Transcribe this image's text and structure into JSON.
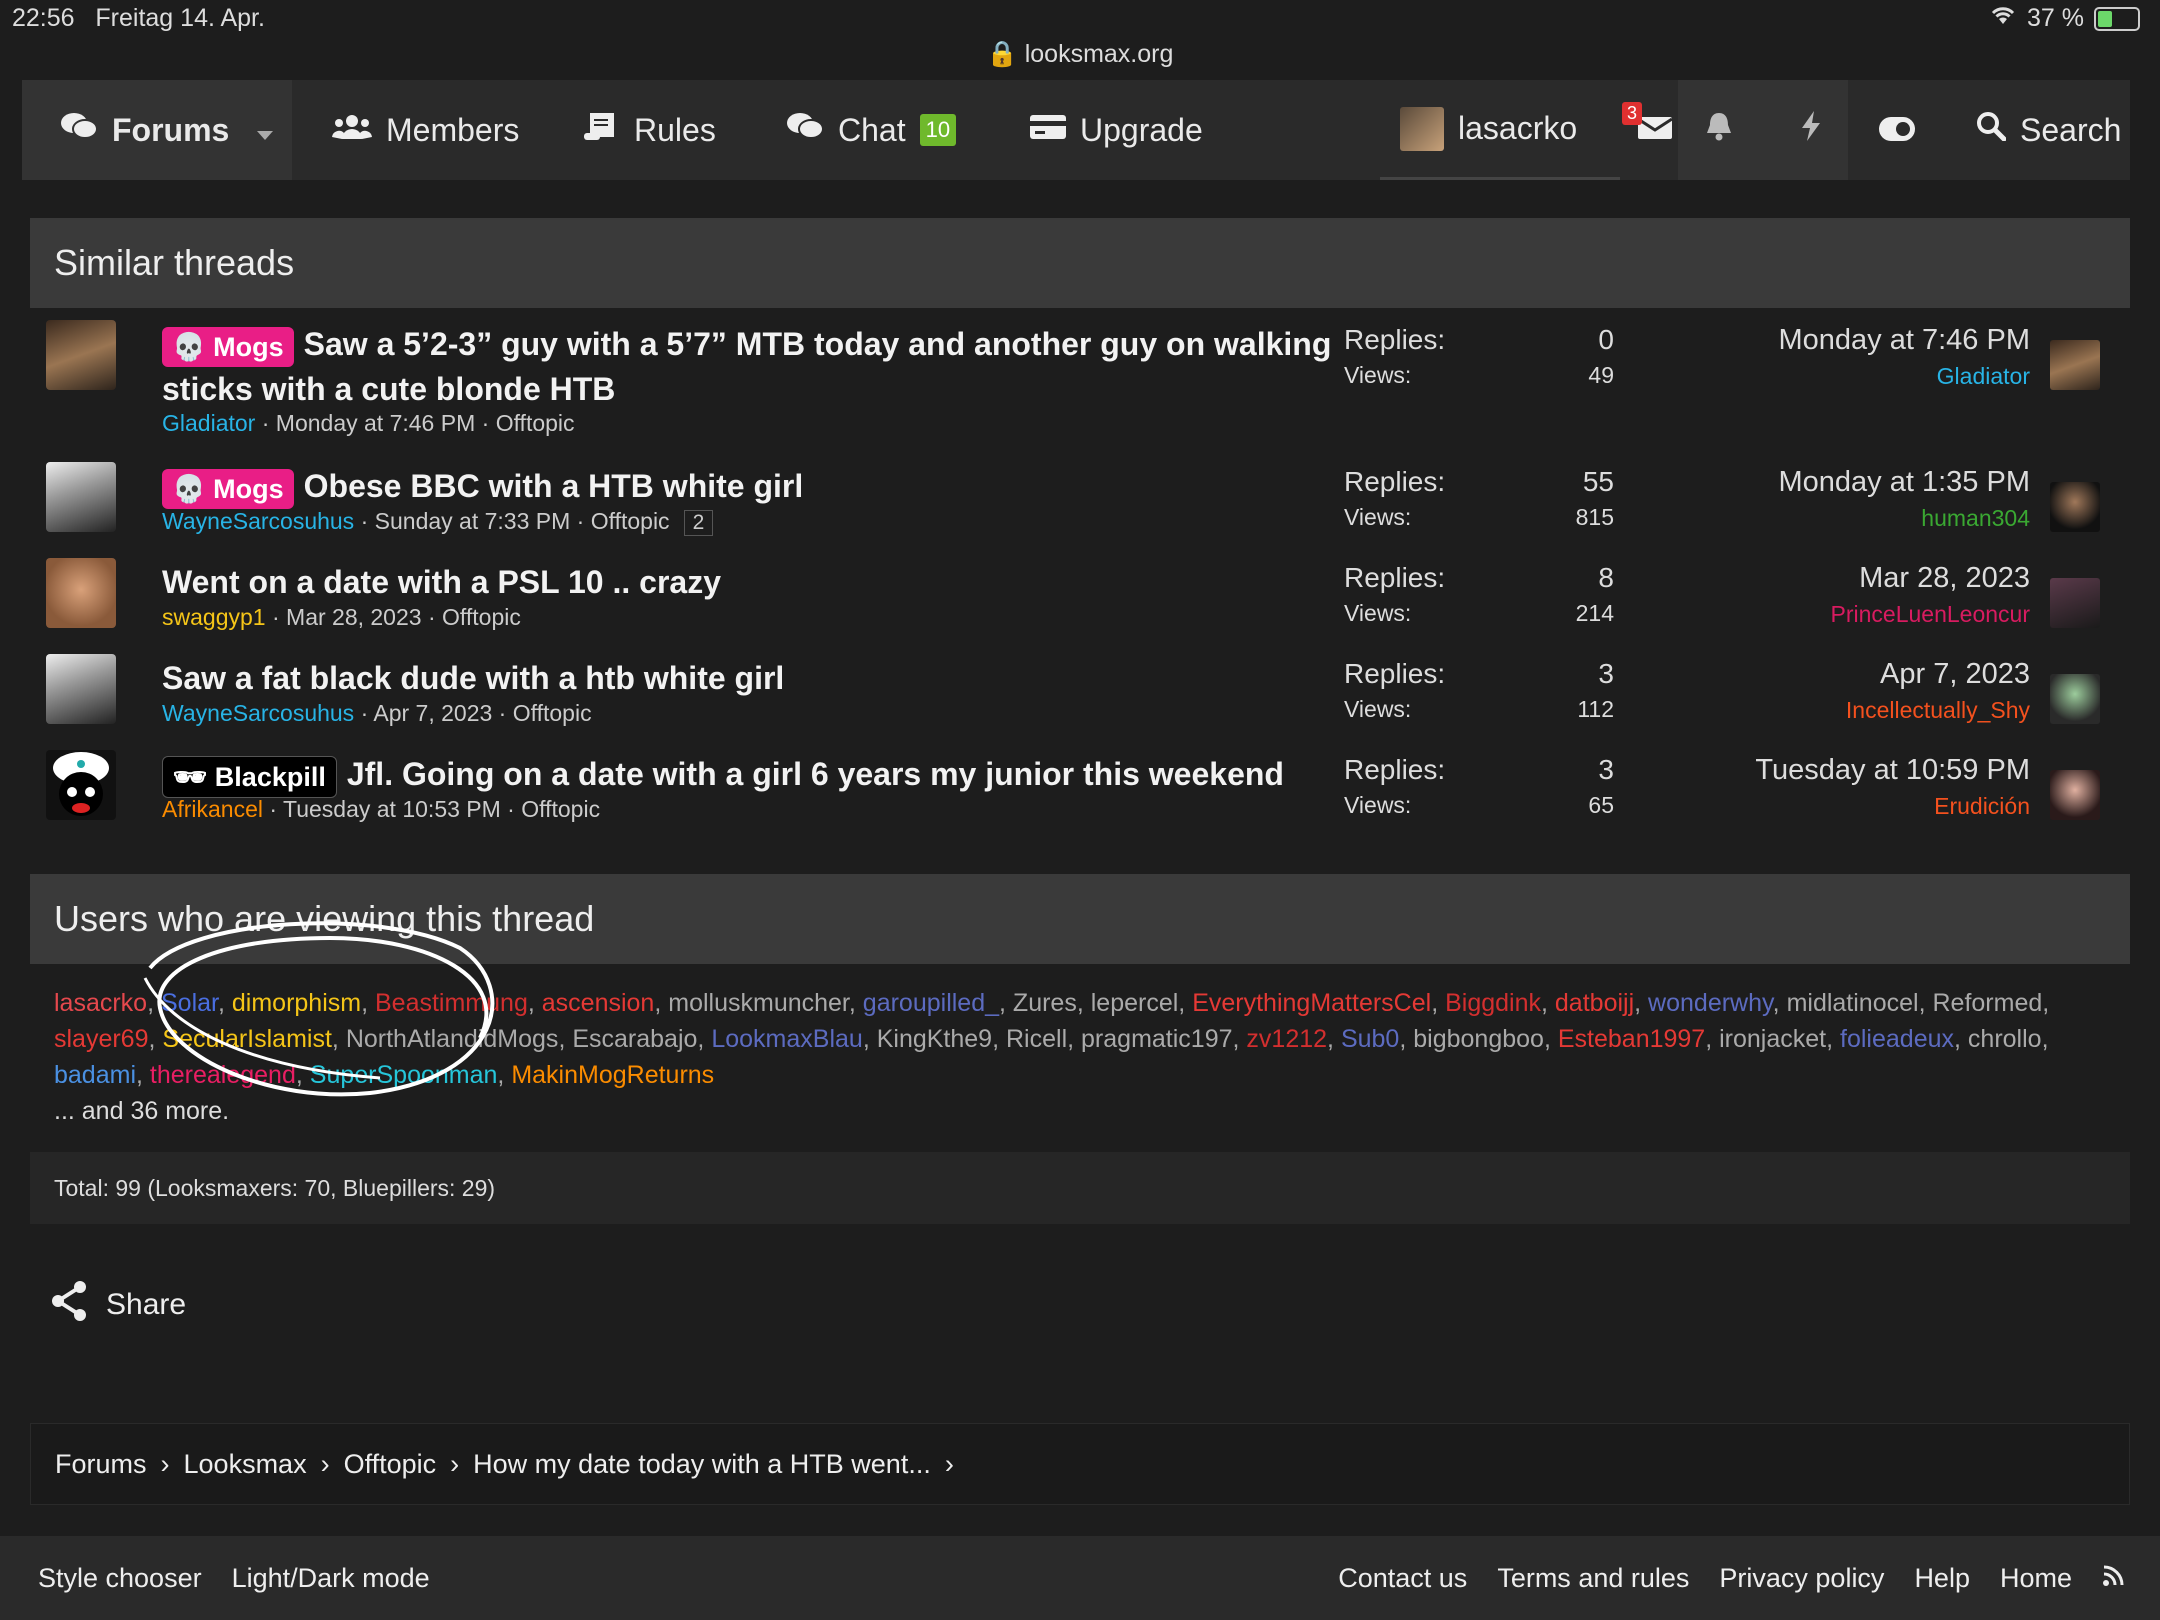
{
  "status": {
    "time": "22:56",
    "date": "Freitag 14. Apr.",
    "url": "looksmax.org",
    "battery": "37 %"
  },
  "nav": {
    "forums": "Forums",
    "members": "Members",
    "rules": "Rules",
    "chat": "Chat",
    "chat_badge": "10",
    "upgrade": "Upgrade",
    "username": "lasacrko",
    "inbox_badge": "3",
    "search": "Search"
  },
  "similar": {
    "heading": "Similar threads",
    "threads": [
      {
        "label": "Mogs",
        "title": "Saw a 5’2-3” guy with a 5’7” MTB today and another guy on walking sticks with a cute blonde HTB",
        "author": "Gladiator",
        "date": "Monday at 7:46 PM",
        "forum": "Offtopic",
        "pages": "",
        "replies_label": "Replies:",
        "replies": "0",
        "views_label": "Views:",
        "views": "49",
        "last_date": "Monday at 7:46 PM",
        "last_user": "Gladiator"
      },
      {
        "label": "Mogs",
        "title": "Obese BBC with a HTB white girl",
        "author": "WayneSarcosuhus",
        "date": "Sunday at 7:33 PM",
        "forum": "Offtopic",
        "pages": "2",
        "replies_label": "Replies:",
        "replies": "55",
        "views_label": "Views:",
        "views": "815",
        "last_date": "Monday at 1:35 PM",
        "last_user": "human304"
      },
      {
        "label": "",
        "title": "Went on a date with a PSL 10 .. crazy",
        "author": "swaggyp1",
        "date": "Mar 28, 2023",
        "forum": "Offtopic",
        "pages": "",
        "replies_label": "Replies:",
        "replies": "8",
        "views_label": "Views:",
        "views": "214",
        "last_date": "Mar 28, 2023",
        "last_user": "PrinceLuenLeoncur"
      },
      {
        "label": "",
        "title": "Saw a fat black dude with a htb white girl",
        "author": "WayneSarcosuhus",
        "date": "Apr 7, 2023",
        "forum": "Offtopic",
        "pages": "",
        "replies_label": "Replies:",
        "replies": "3",
        "views_label": "Views:",
        "views": "112",
        "last_date": "Apr 7, 2023",
        "last_user": "Incellectually_Shy"
      },
      {
        "label": "Blackpill",
        "title": "Jfl. Going on a date with a girl 6 years my junior this weekend",
        "author": "Afrikancel",
        "date": "Tuesday at 10:53 PM",
        "forum": "Offtopic",
        "pages": "",
        "replies_label": "Replies:",
        "replies": "3",
        "views_label": "Views:",
        "views": "65",
        "last_date": "Tuesday at 10:59 PM",
        "last_user": "Erudición"
      }
    ]
  },
  "viewers": {
    "heading": "Users who are viewing this thread",
    "users": [
      {
        "name": "lasacrko",
        "color": "#e5484d"
      },
      {
        "name": "Solar",
        "color": "#4a6ee0"
      },
      {
        "name": "dimorphism",
        "color": "#f5c518"
      },
      {
        "name": "Beastimmung",
        "color": "#d32f2f"
      },
      {
        "name": "ascension",
        "color": "#e53935"
      },
      {
        "name": "molluskmuncher",
        "color": "#aaaaaa"
      },
      {
        "name": "garoupilled_",
        "color": "#5c6bc0"
      },
      {
        "name": "Zures",
        "color": "#aaaaaa"
      },
      {
        "name": "lepercel",
        "color": "#aaaaaa"
      },
      {
        "name": "EverythingMattersCel",
        "color": "#e53935"
      },
      {
        "name": "Biggdink",
        "color": "#d32f2f"
      },
      {
        "name": "datboijj",
        "color": "#e53935"
      },
      {
        "name": "wonderwhy",
        "color": "#5c6bc0"
      },
      {
        "name": "midlatinocel",
        "color": "#aaaaaa"
      },
      {
        "name": "Reformed",
        "color": "#aaaaaa"
      },
      {
        "name": "slayer69",
        "color": "#e53935"
      },
      {
        "name": "SecularIslamist",
        "color": "#f5c518"
      },
      {
        "name": "NorthAtlandidMogs",
        "color": "#aaaaaa"
      },
      {
        "name": "Escarabajo",
        "color": "#aaaaaa"
      },
      {
        "name": "LookmaxBlau",
        "color": "#5c6bc0"
      },
      {
        "name": "KingKthe9",
        "color": "#aaaaaa"
      },
      {
        "name": "Ricell",
        "color": "#aaaaaa"
      },
      {
        "name": "pragmatic197",
        "color": "#aaaaaa"
      },
      {
        "name": "zv1212",
        "color": "#d32f2f"
      },
      {
        "name": "Sub0",
        "color": "#5c6bc0"
      },
      {
        "name": "bigbongboo",
        "color": "#aaaaaa"
      },
      {
        "name": "Esteban1997",
        "color": "#e53935"
      },
      {
        "name": "ironjacket",
        "color": "#aaaaaa"
      },
      {
        "name": "folieadeux",
        "color": "#5c6bc0"
      },
      {
        "name": "chrollo",
        "color": "#aaaaaa"
      },
      {
        "name": "badami",
        "color": "#4a90e2"
      },
      {
        "name": "therealegend",
        "color": "#e91e63"
      },
      {
        "name": "SuperSpoonman",
        "color": "#26c6da"
      },
      {
        "name": "MakinMogReturns",
        "color": "#fb8c00"
      }
    ],
    "more": "... and 36 more.",
    "total": "Total: 99 (Looksmaxers: 70, Bluepillers: 29)"
  },
  "share": "Share",
  "breadcrumb": [
    "Forums",
    "Looksmax",
    "Offtopic",
    "How my date today with a HTB went..."
  ],
  "footer": {
    "left": [
      "Style chooser",
      "Light/Dark mode"
    ],
    "right": [
      "Contact us",
      "Terms and rules",
      "Privacy policy",
      "Help",
      "Home"
    ]
  },
  "colors": {
    "author_blue": "#28b4e6",
    "author_yellow": "#f5c518",
    "author_orange": "#fb8c00",
    "human_green": "#3aa832",
    "prince_red": "#d81b60",
    "shy_orange": "#f4511e",
    "erud_red": "#f4511e",
    "mogs_pink": "#e91e86"
  }
}
